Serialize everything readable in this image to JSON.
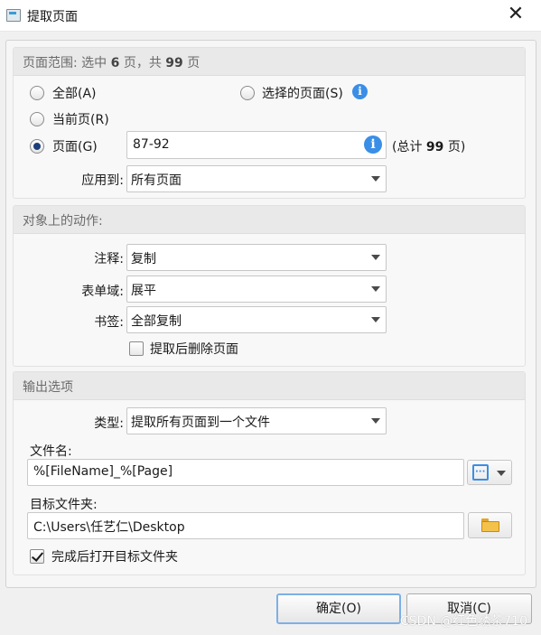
{
  "window": {
    "title": "提取页面",
    "close_glyph": "✕"
  },
  "page_range": {
    "header_prefix": "页面范围: 选中",
    "selected_count": "6",
    "header_mid": "页，共",
    "total_count": "99",
    "header_suffix": "页",
    "all_label": "全部(A)",
    "selected_pages_label": "选择的页面(S)",
    "current_page_label": "当前页(R)",
    "pages_label": "页面(G)",
    "pages_value": "87-92",
    "total_prefix": "(总计",
    "total_value": "99",
    "total_suffix": "页)",
    "apply_to_label": "应用到:",
    "apply_to_value": "所有页面",
    "selected_option": "pages"
  },
  "object_actions": {
    "header": "对象上的动作:",
    "annotation_label": "注释:",
    "annotation_value": "复制",
    "form_field_label": "表单域:",
    "form_field_value": "展平",
    "bookmark_label": "书签:",
    "bookmark_value": "全部复制",
    "delete_after_label": "提取后删除页面",
    "delete_after_checked": false
  },
  "output": {
    "header": "输出选项",
    "type_label": "类型:",
    "type_value": "提取所有页面到一个文件",
    "filename_label": "文件名:",
    "filename_value": "%[FileName]_%[Page]",
    "macro_glyph": "[···]",
    "target_label": "目标文件夹:",
    "target_value": "C:\\Users\\任艺仁\\Desktop",
    "open_after_label": "完成后打开目标文件夹",
    "open_after_checked": true
  },
  "buttons": {
    "ok": "确定(O)",
    "cancel": "取消(C)"
  },
  "watermark": "CSDN @红色绣茶710",
  "icons": {
    "info": "i",
    "info_color": "#3a8ee6",
    "accent": "#7cb0e6"
  }
}
